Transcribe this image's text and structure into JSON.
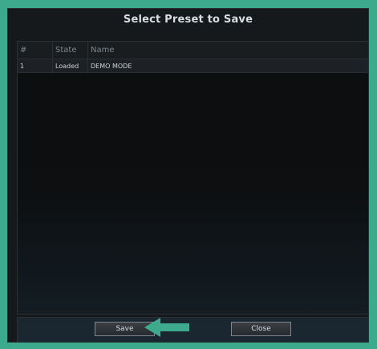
{
  "dialog": {
    "title": "Select Preset to Save"
  },
  "table": {
    "columns": [
      "#",
      "State",
      "Name"
    ],
    "rows": [
      {
        "num": "1",
        "state": "Loaded",
        "name": "DEMO MODE"
      }
    ]
  },
  "buttons": {
    "save_label": "Save",
    "close_label": "Close"
  },
  "colors": {
    "background": "#3daa8e",
    "dialog": "#16191c",
    "accent_arrow": "#3daa8e"
  },
  "icons": {
    "save_pointer": "left-arrow-icon"
  }
}
